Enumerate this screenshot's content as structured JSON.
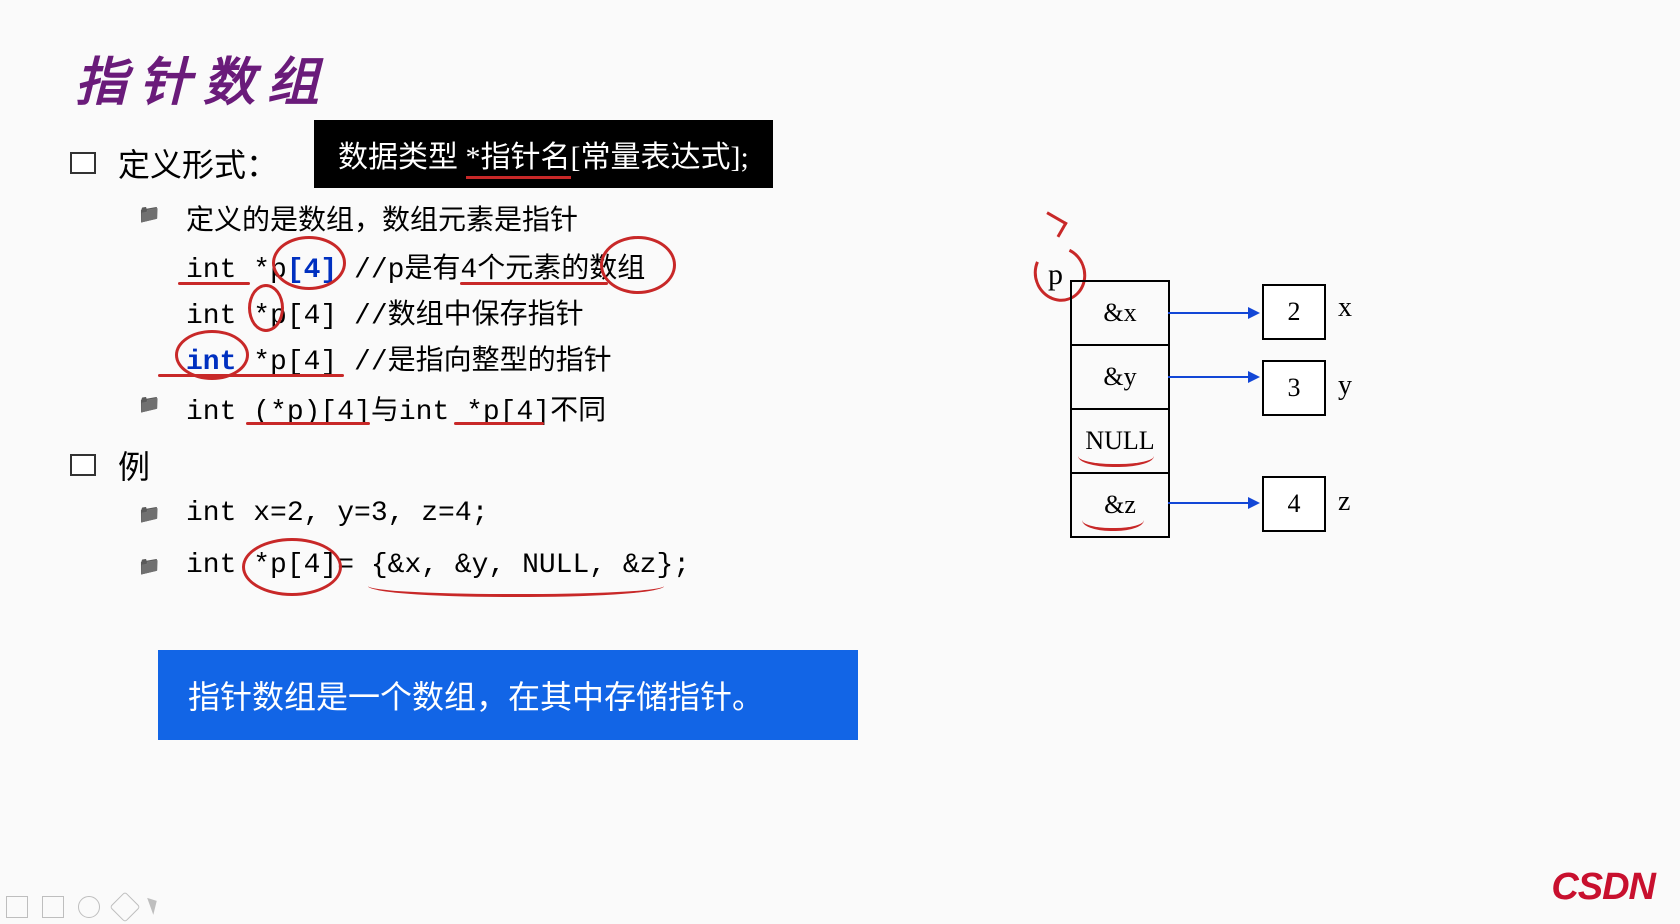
{
  "title": "指针数组",
  "section1": {
    "label": "定义形式：",
    "syntax_prefix": "数据类型 ",
    "syntax_mid": "*指针名",
    "syntax_suffix": "[常量表达式];",
    "sub1": "定义的是数组，数组元素是指针",
    "line1_code": "int *p",
    "line1_bracket": "[4]",
    "line1_comment": "  //p是有4个元素的数组",
    "line2": "int *p[4]  //数组中保存指针",
    "line3_a": "int",
    "line3_b": " *p[4]  //是指向整型的指针",
    "sub2_a": "int ",
    "sub2_b": "(*p)[4]",
    "sub2_c": "与int ",
    "sub2_d": "*p[4]",
    "sub2_e": "不同"
  },
  "section2": {
    "label": "例",
    "line1": "int x=2, y=3, z=4;",
    "line2_a": "int ",
    "line2_b": "*p[4]",
    "line2_c": "= {&x, &y, NULL, &z};"
  },
  "summary": "指针数组是一个数组，在其中存储指针。",
  "diagram": {
    "p_label": "p",
    "cells": [
      "&x",
      "&y",
      "NULL",
      "&z"
    ],
    "values": [
      "2",
      "3",
      "4"
    ],
    "vars": [
      "x",
      "y",
      "z"
    ]
  },
  "watermark": "CSDN"
}
